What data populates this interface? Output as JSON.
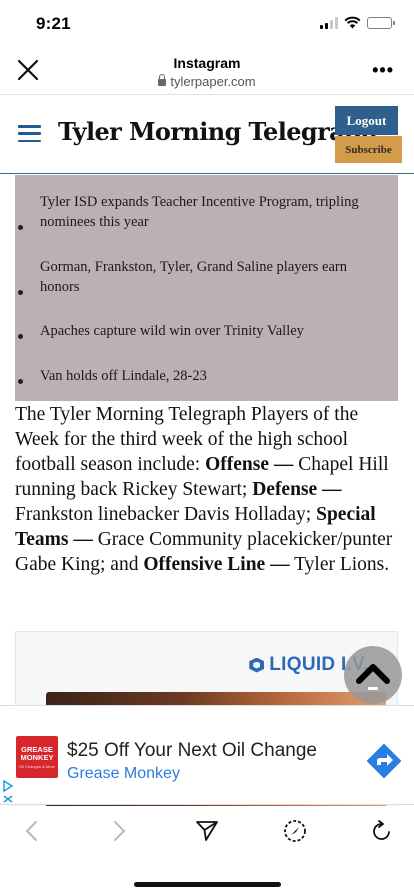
{
  "status_bar": {
    "time": "9:21"
  },
  "browser": {
    "app_title": "Instagram",
    "url": "tylerpaper.com",
    "more_label": "•••"
  },
  "site": {
    "masthead": "Tyler Morning Telegraph",
    "logout_label": "Logout",
    "subscribe_label": "Subscribe"
  },
  "related_headlines": [
    "Tyler ISD expands Teacher Incentive Program, tripling nominees this year",
    "Gorman, Frankston, Tyler, Grand Saline players earn honors",
    "Apaches capture wild win over Trinity Valley",
    "Van holds off Lindale, 28-23"
  ],
  "article": {
    "intro": "The Tyler Morning Telegraph Players of the Week for the third week of the high school football season include: ",
    "offense_label": "Offense —",
    "offense_text": " Chapel Hill running back Rickey Stewart; ",
    "defense_label": "Defense —",
    "defense_text": " Frankston linebacker Davis Holladay; ",
    "special_label": "Special Teams —",
    "special_text": " Grace Community placekicker/punter Gabe King; and ",
    "oline_label": "Offensive Line —",
    "oline_text": " Tyler Lions."
  },
  "ad_card": {
    "brand": "LIQUID I.V."
  },
  "ad_banner": {
    "logo_text": "GREASE MONKEY",
    "logo_sub": "Oil Changes & More",
    "headline": "$25 Off Your Next Oil Change",
    "brand": "Grease Monkey"
  },
  "colors": {
    "masthead_rule": "#2c6f9e",
    "logout_bg": "#2f5f8c",
    "subscribe_bg": "#d49b4a",
    "related_bg": "#bcb1b2",
    "ad_accent": "#2a7de1"
  },
  "icons": {
    "close": "close-icon",
    "menu": "hamburger-menu-icon",
    "scroll_top": "chevron-up-icon",
    "ad_go": "arrow-right-icon",
    "back": "chevron-left-icon",
    "forward": "chevron-right-icon",
    "share": "send-icon",
    "safari": "compass-icon",
    "reload": "reload-icon"
  }
}
